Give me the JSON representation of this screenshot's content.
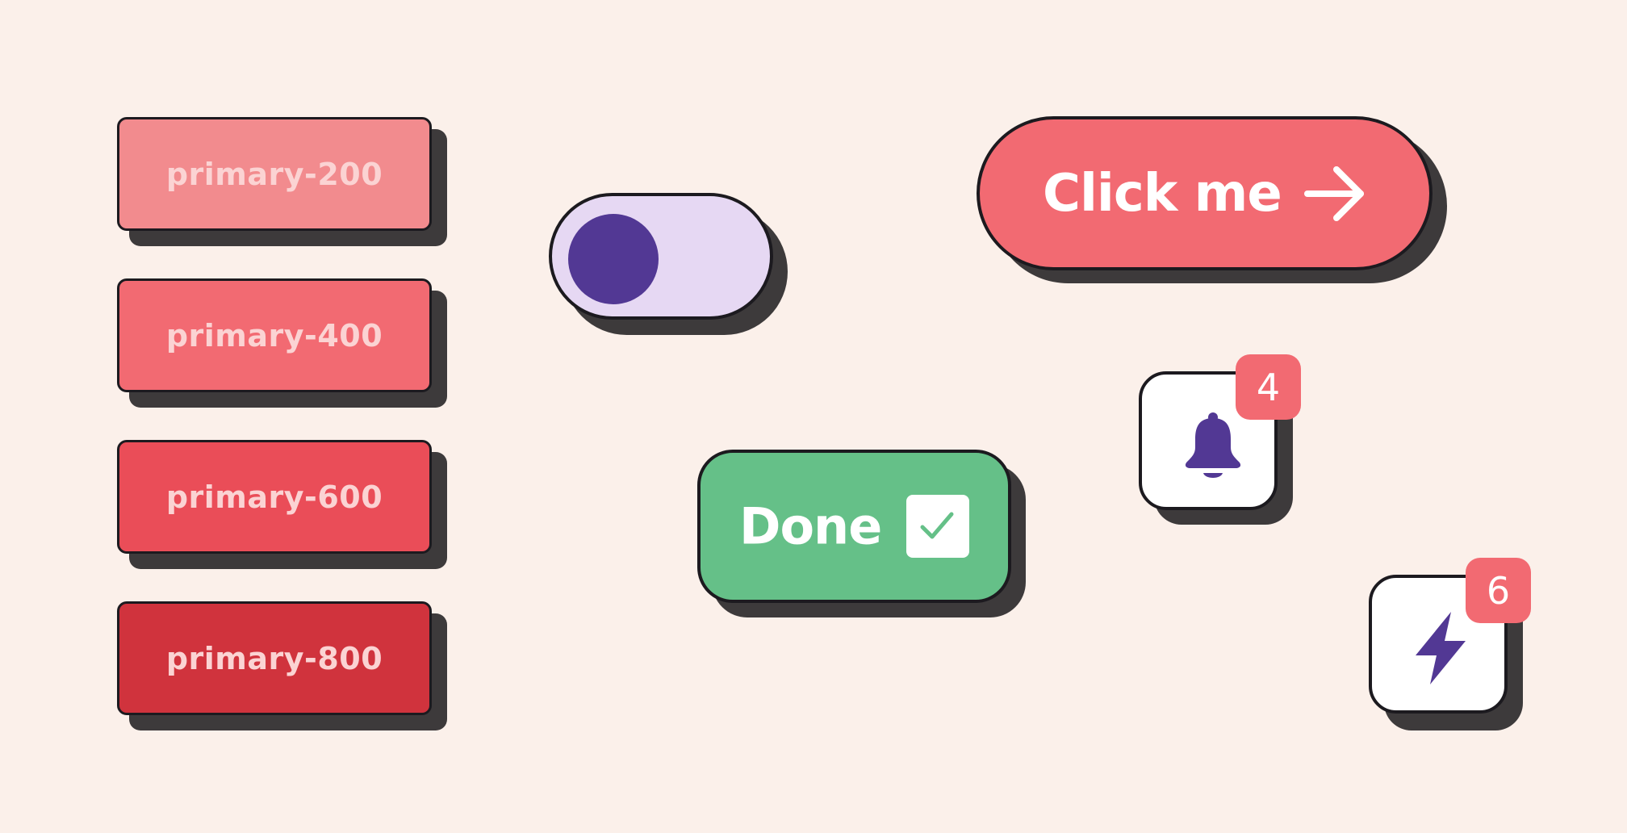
{
  "colors": {
    "background": "#fbf0ea",
    "outline": "#1c1a1f",
    "shadow": "#3d3a3b",
    "primary_200": "#f28b8e",
    "primary_400": "#f26a72",
    "primary_600": "#ea4d58",
    "primary_800": "#d0333d",
    "swatch_text": "#fbd3d3",
    "toggle_track": "#e6d8f3",
    "toggle_knob": "#523894",
    "done_green": "#65c088",
    "icon_purple": "#523894",
    "badge": "#f26a72"
  },
  "swatches": [
    {
      "label": "primary-200",
      "color": "#f28b8e"
    },
    {
      "label": "primary-400",
      "color": "#f26a72"
    },
    {
      "label": "primary-600",
      "color": "#ea4d58"
    },
    {
      "label": "primary-800",
      "color": "#d0333d"
    }
  ],
  "toggle": {
    "state": "off"
  },
  "cta_button": {
    "label": "Click me",
    "icon": "arrow-right-icon"
  },
  "done_button": {
    "label": "Done",
    "icon": "checkbox-checked-icon"
  },
  "notifications": {
    "icon": "bell-icon",
    "badge_count": "4"
  },
  "alerts": {
    "icon": "lightning-bolt-icon",
    "badge_count": "6"
  }
}
